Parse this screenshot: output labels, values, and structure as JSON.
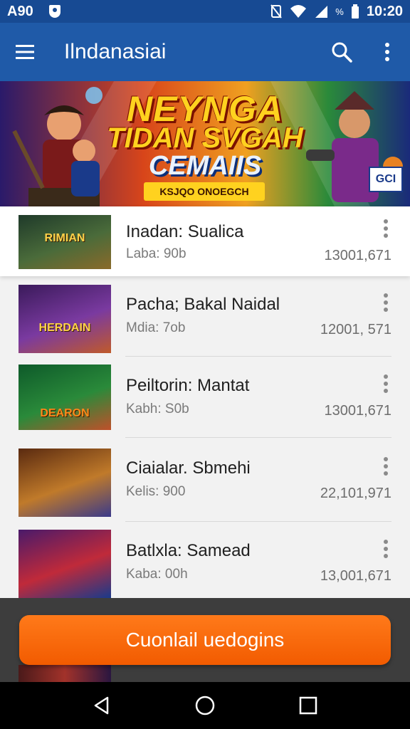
{
  "status_bar": {
    "left_text": "A90",
    "battery_percent": "%",
    "time": "10:20"
  },
  "app_bar": {
    "title": "Ilndanasiai",
    "icons": [
      "menu-icon",
      "search-icon",
      "more-vert-icon"
    ]
  },
  "banner": {
    "line1": "NEYNGA",
    "line2": "TIDAN SVGAH",
    "line3": "CEMAIIS",
    "tag": "KSJQO ONOEGCH",
    "logo_text": "GCI"
  },
  "items": [
    {
      "title": "Inadan: Sualica",
      "subtitle": "Laba: 90b",
      "number": "13001,671",
      "thumb_text": "RIMIAN",
      "active": true,
      "thumb_colors": [
        "#1f3a2a",
        "#4a6b3a",
        "#8a6a2a"
      ]
    },
    {
      "title": "Pacha; Bakal Naidal",
      "subtitle": "Mdia: 7ob",
      "number": "12001, 571",
      "thumb_text": "HERDAIN",
      "active": false,
      "thumb_colors": [
        "#3a1a5a",
        "#7a3aa0",
        "#c05a2a"
      ]
    },
    {
      "title": "Peiltorin: Mantat",
      "subtitle": "Kabh: S0b",
      "number": "13001,671",
      "thumb_text": "DEARON",
      "active": false,
      "thumb_colors": [
        "#0e5a2a",
        "#2a8a3a",
        "#c0502a"
      ]
    },
    {
      "title": "Ciaialar. Sbmehi",
      "subtitle": "Kelis: 900",
      "number": "22,101,971",
      "thumb_text": "",
      "active": false,
      "thumb_colors": [
        "#5a2a10",
        "#c07a2a",
        "#3a3a8a"
      ]
    },
    {
      "title": "Batlxla: Samead",
      "subtitle": "Kaba: 00h",
      "number": "13,001,671",
      "thumb_text": "",
      "active": false,
      "thumb_colors": [
        "#4a1a6a",
        "#c02a3a",
        "#1a3a8a"
      ]
    }
  ],
  "cta": {
    "label": "Cuonlail uedogins"
  },
  "nav_bar": {
    "icons": [
      "back-icon",
      "home-icon",
      "recents-icon"
    ]
  },
  "colors": {
    "status_bar": "#174a93",
    "app_bar": "#1f5aa8",
    "cta": "#f25b00"
  }
}
